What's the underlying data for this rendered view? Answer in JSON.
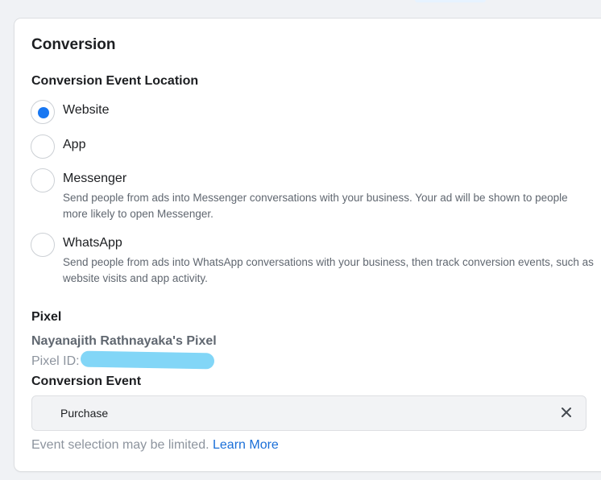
{
  "section": {
    "title": "Conversion"
  },
  "location": {
    "heading": "Conversion Event Location",
    "options": [
      {
        "label": "Website",
        "selected": true,
        "description": ""
      },
      {
        "label": "App",
        "selected": false,
        "description": ""
      },
      {
        "label": "Messenger",
        "selected": false,
        "description": "Send people from ads into Messenger conversations with your business. Your ad will be shown to people more likely to open Messenger."
      },
      {
        "label": "WhatsApp",
        "selected": false,
        "description": "Send people from ads into WhatsApp conversations with your business, then track conversion events, such as website visits and app activity."
      }
    ]
  },
  "pixel": {
    "heading": "Pixel",
    "name": "Nayanajith Rathnayaka's Pixel",
    "id_label": "Pixel ID:"
  },
  "conversion_event": {
    "heading": "Conversion Event",
    "selected_value": "Purchase",
    "hint": "Event selection may be limited.",
    "link": "Learn More"
  },
  "colors": {
    "accent": "#1877f2",
    "link": "#1a6fd8",
    "redaction": "#82d6f7"
  },
  "icons": {
    "clear": "close-icon"
  }
}
